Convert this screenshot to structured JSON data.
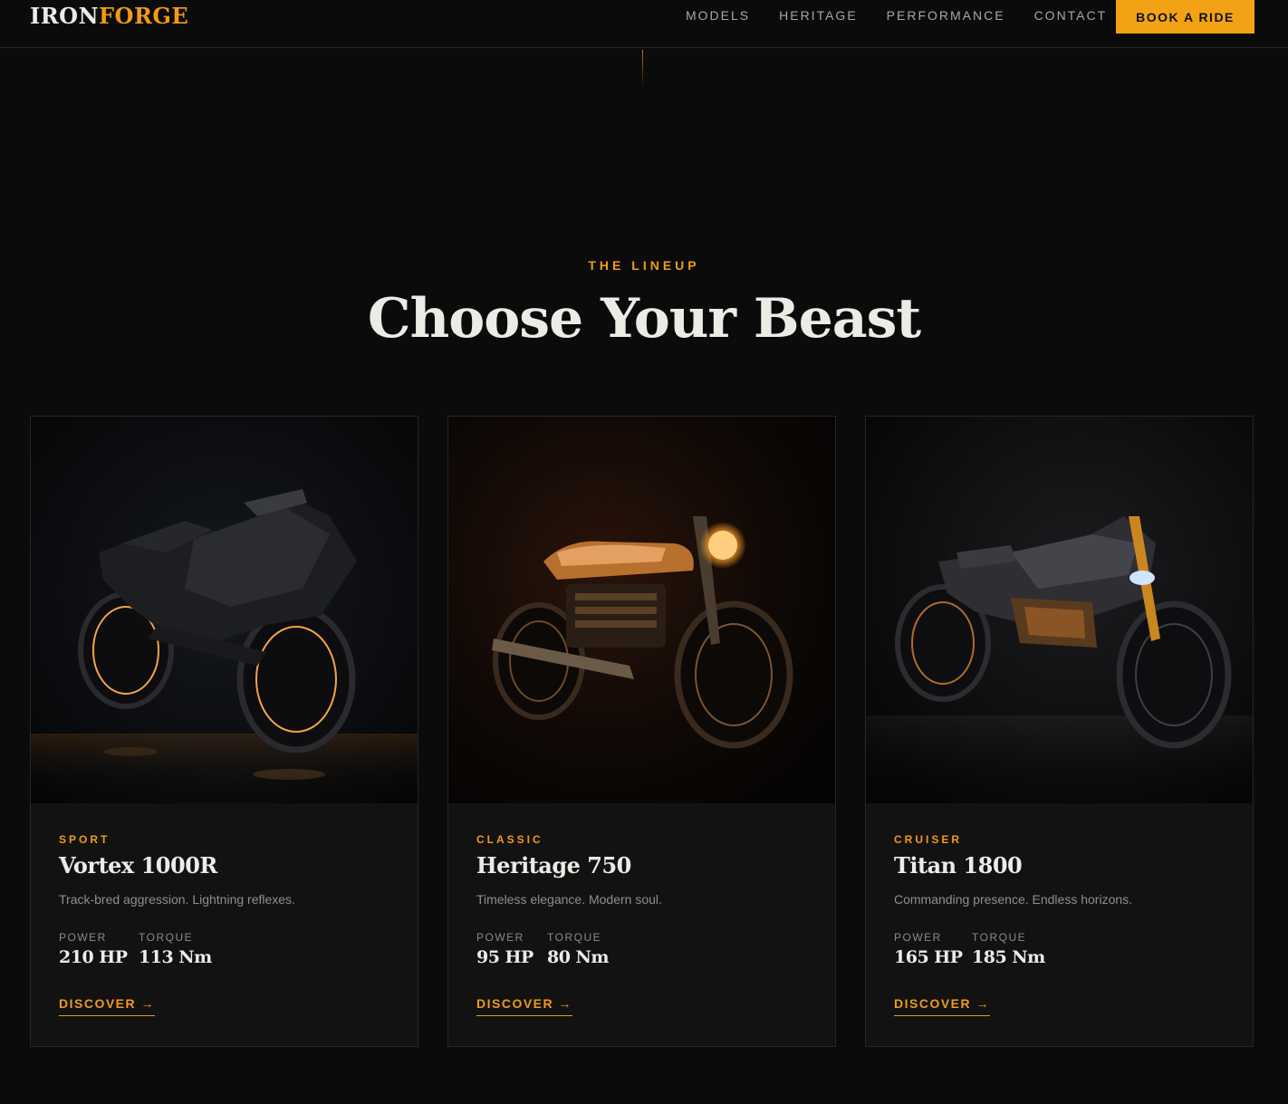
{
  "nav": {
    "logo_part1": "IRON",
    "logo_part2": "FORGE",
    "links": [
      "MODELS",
      "HERITAGE",
      "PERFORMANCE",
      "CONTACT"
    ],
    "cta": "BOOK A RIDE"
  },
  "section": {
    "eyebrow": "THE LINEUP",
    "title": "Choose Your Beast"
  },
  "cards": [
    {
      "category": "SPORT",
      "name": "Vortex 1000R",
      "tagline": "Track-bred aggression. Lightning reflexes.",
      "power_label": "POWER",
      "power": "210 HP",
      "torque_label": "TORQUE",
      "torque": "113 Nm",
      "cta": "DISCOVER →"
    },
    {
      "category": "CLASSIC",
      "name": "Heritage 750",
      "tagline": "Timeless elegance. Modern soul.",
      "power_label": "POWER",
      "power": "95 HP",
      "torque_label": "TORQUE",
      "torque": "80 Nm",
      "cta": "DISCOVER →"
    },
    {
      "category": "CRUISER",
      "name": "Titan 1800",
      "tagline": "Commanding presence. Endless horizons.",
      "power_label": "POWER",
      "power": "165 HP",
      "torque_label": "TORQUE",
      "torque": "185 Nm",
      "cta": "DISCOVER →"
    }
  ],
  "colors": {
    "background": "#0b0b0b",
    "card": "#121212",
    "accent": "#f19a18",
    "cta_bg": "#f2a214",
    "text": "#ecebe6",
    "muted": "#8f8f8f"
  },
  "images": [
    "motorcycle-sport-image",
    "motorcycle-classic-image",
    "motorcycle-cruiser-image"
  ]
}
